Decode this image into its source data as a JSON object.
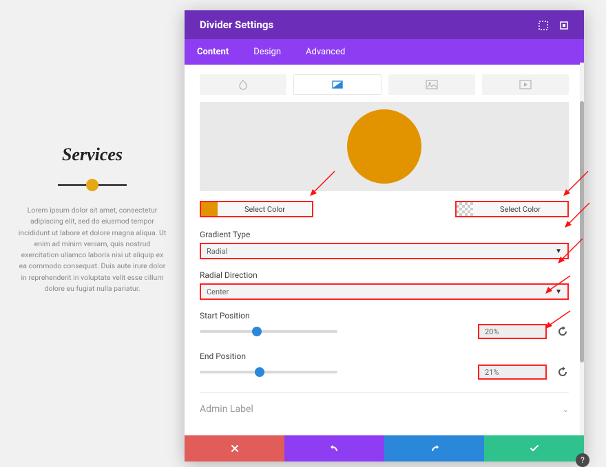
{
  "preview": {
    "title": "Services",
    "text": "Lorem ipsum dolor sit amet, consectetur adipiscing elit, sed do eiusmod tempor incididunt ut labore et dolore magna aliqua. Ut enim ad minim veniam, quis nostrud exercitation ullamco laboris nisi ut aliquip ex ea commodo consequat. Duis aute irure dolor in reprehenderit in voluptate velit esse cillum dolore eu fugiat nulla pariatur."
  },
  "panel": {
    "title": "Divider Settings",
    "tabs": {
      "content": "Content",
      "design": "Design",
      "advanced": "Advanced"
    },
    "color1_label": "Select Color",
    "color2_label": "Select Color",
    "gradient_type_label": "Gradient Type",
    "gradient_type_value": "Radial",
    "radial_direction_label": "Radial Direction",
    "radial_direction_value": "Center",
    "start_position_label": "Start Position",
    "start_position_value": "20%",
    "end_position_label": "End Position",
    "end_position_value": "21%",
    "accordion_label": "Admin Label"
  },
  "colors": {
    "swatch1": "#e29300",
    "accent_purple": "#8e3df2",
    "accent_blue": "#2b87da",
    "accent_green": "#2fc28d",
    "accent_red": "#e15d59",
    "highlight": "#ff2020"
  }
}
